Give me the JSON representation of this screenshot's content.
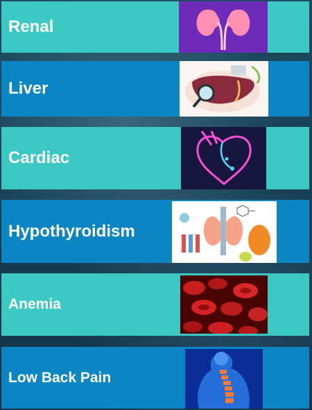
{
  "items": [
    {
      "label": "Renal",
      "image": "kidneys-illustration"
    },
    {
      "label": "Liver",
      "image": "liver-illustration"
    },
    {
      "label": "Cardiac",
      "image": "heart-illustration"
    },
    {
      "label": "Hypothyroidism",
      "image": "thyroid-illustration"
    },
    {
      "label": "Anemia",
      "image": "red-blood-cells-photo"
    },
    {
      "label": "Low Back Pain",
      "image": "spine-illustration"
    }
  ]
}
